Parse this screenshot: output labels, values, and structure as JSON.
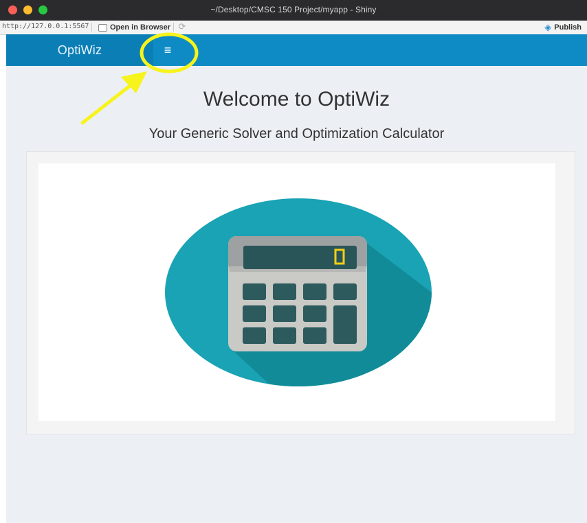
{
  "window": {
    "title": "~/Desktop/CMSC 150 Project/myapp - Shiny"
  },
  "toolbar": {
    "url": "http://127.0.0.1:5567",
    "open_browser_label": "Open in Browser",
    "publish_label": "Publish"
  },
  "app": {
    "brand": "OptiWiz",
    "toggle_icon": "≡",
    "heading": "Welcome to OptiWiz",
    "subheading": "Your Generic Solver and Optimization Calculator"
  },
  "colors": {
    "navbar": "#0e8bc4",
    "brand_bg": "#0b7fb5",
    "highlight": "#f7f31c",
    "teal_circle": "#19a3b4"
  },
  "icons": [
    "calculator-illustration",
    "menu-toggle-icon",
    "publish-icon",
    "refresh-icon"
  ]
}
